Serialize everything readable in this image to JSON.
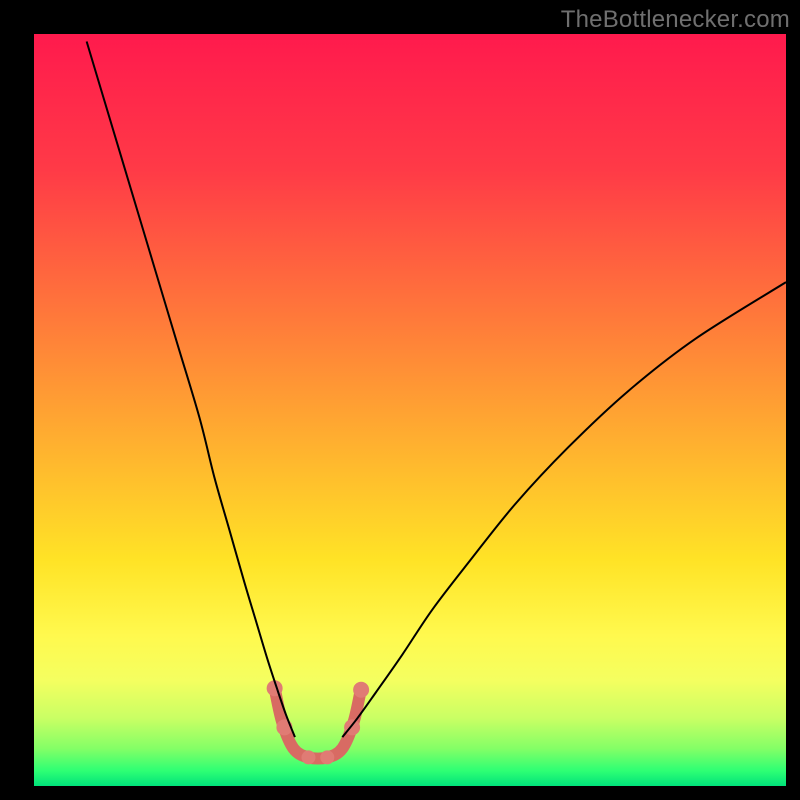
{
  "watermark": "TheBottlenecker.com",
  "chart_data": {
    "type": "line",
    "title": "",
    "xlabel": "",
    "ylabel": "",
    "xlim": [
      0,
      100
    ],
    "ylim": [
      0,
      100
    ],
    "grid": false,
    "legend": false,
    "background_gradient": {
      "type": "linear-vertical",
      "stops": [
        {
          "offset": 0.0,
          "color": "#ff1a4d"
        },
        {
          "offset": 0.18,
          "color": "#ff3a47"
        },
        {
          "offset": 0.38,
          "color": "#ff7a3a"
        },
        {
          "offset": 0.55,
          "color": "#ffb22f"
        },
        {
          "offset": 0.7,
          "color": "#ffe326"
        },
        {
          "offset": 0.8,
          "color": "#fff94e"
        },
        {
          "offset": 0.86,
          "color": "#f4ff60"
        },
        {
          "offset": 0.91,
          "color": "#c9ff64"
        },
        {
          "offset": 0.95,
          "color": "#84ff66"
        },
        {
          "offset": 0.98,
          "color": "#2dff74"
        },
        {
          "offset": 1.0,
          "color": "#00e27a"
        }
      ]
    },
    "series": [
      {
        "name": "left-branch",
        "stroke": "#000000",
        "stroke_width": 2,
        "x": [
          7.0,
          10.0,
          13.0,
          16.0,
          19.0,
          22.0,
          24.0,
          26.0,
          28.0,
          29.5,
          31.0,
          32.3,
          33.5,
          34.7
        ],
        "y": [
          99.0,
          89.0,
          79.0,
          69.0,
          59.0,
          49.0,
          41.0,
          34.0,
          27.0,
          22.0,
          17.0,
          13.0,
          9.5,
          6.5
        ]
      },
      {
        "name": "right-branch",
        "stroke": "#000000",
        "stroke_width": 2,
        "x": [
          41.0,
          43.0,
          45.5,
          49.0,
          53.0,
          58.0,
          64.0,
          71.0,
          79.0,
          88.0,
          100.0
        ],
        "y": [
          6.5,
          9.0,
          12.5,
          17.5,
          23.5,
          30.0,
          37.5,
          45.0,
          52.5,
          59.5,
          67.0
        ]
      },
      {
        "name": "valley-polyline",
        "stroke": "#d86b63",
        "stroke_width": 12,
        "linecap": "round",
        "linejoin": "round",
        "x": [
          32.0,
          33.0,
          34.5,
          36.5,
          39.0,
          41.0,
          42.5,
          43.5
        ],
        "y": [
          13.0,
          8.5,
          5.0,
          3.8,
          3.8,
          5.0,
          8.5,
          13.0
        ]
      }
    ],
    "markers": [
      {
        "name": "left-marker-upper",
        "x": 32.0,
        "y": 13.0,
        "r": 8,
        "fill": "#e07b74"
      },
      {
        "name": "left-marker-lower",
        "x": 33.3,
        "y": 7.8,
        "r": 8,
        "fill": "#e07b74"
      },
      {
        "name": "right-marker-upper",
        "x": 43.5,
        "y": 12.8,
        "r": 8,
        "fill": "#e07b74"
      },
      {
        "name": "right-marker-lower",
        "x": 42.3,
        "y": 7.8,
        "r": 8,
        "fill": "#e07b74"
      },
      {
        "name": "bottom-marker-left",
        "x": 36.5,
        "y": 3.8,
        "r": 7,
        "fill": "#e07b74"
      },
      {
        "name": "bottom-marker-right",
        "x": 39.0,
        "y": 3.8,
        "r": 7,
        "fill": "#e07b74"
      }
    ]
  }
}
